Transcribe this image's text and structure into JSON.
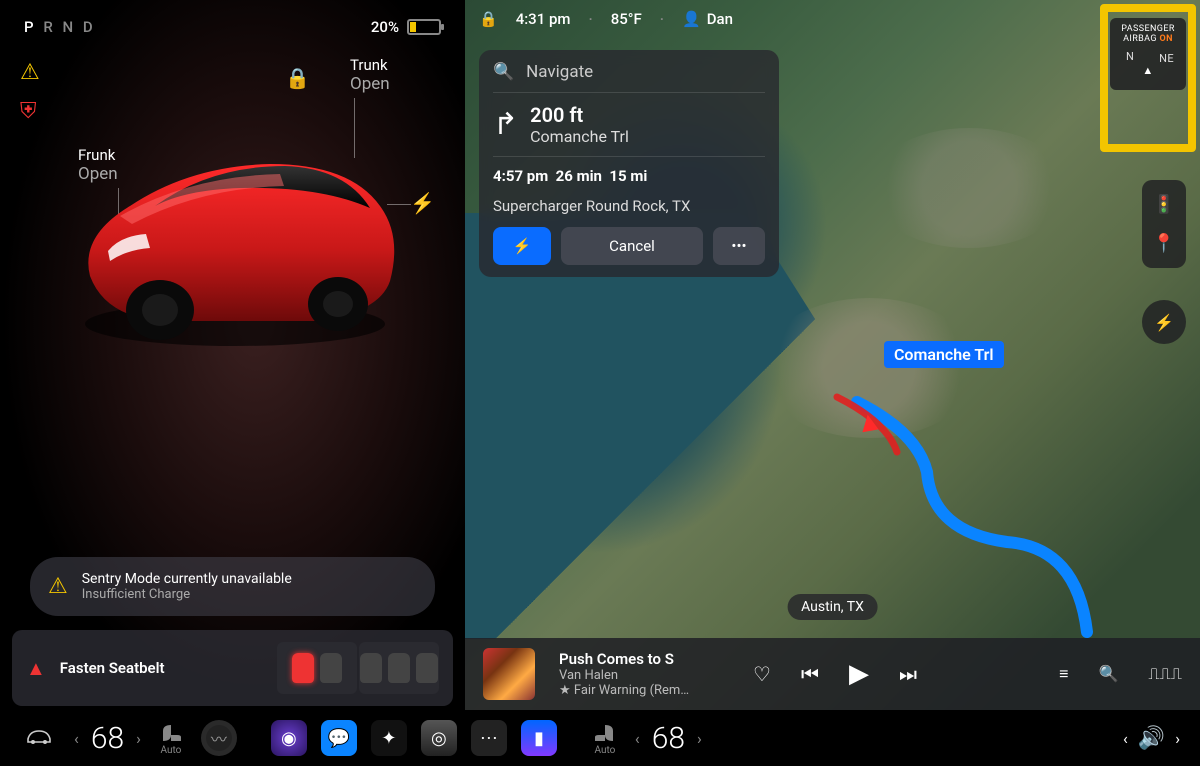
{
  "left": {
    "gears": [
      "P",
      "R",
      "N",
      "D"
    ],
    "active_gear": "P",
    "battery_pct": "20%",
    "trunk_label": "Trunk",
    "trunk_action": "Open",
    "frunk_label": "Frunk",
    "frunk_action": "Open",
    "sentry_title": "Sentry Mode currently unavailable",
    "sentry_sub": "Insufficient Charge",
    "seatbelt_warn": "Fasten Seatbelt"
  },
  "status": {
    "time": "4:31 pm",
    "temp": "85°F",
    "user": "Dan"
  },
  "nav": {
    "search_placeholder": "Navigate",
    "turn_distance": "200 ft",
    "turn_street": "Comanche Trl",
    "eta_time": "4:57 pm",
    "eta_dur": "26 min",
    "eta_dist": "15 mi",
    "destination": "Supercharger Round Rock, TX",
    "cancel": "Cancel",
    "map_road_label": "Comanche Trl",
    "map_city": "Austin, TX"
  },
  "airbag": {
    "line1": "PASSENGER",
    "line2": "AIRBAG",
    "status": "ON",
    "compass_n": "N",
    "compass_ne": "NE"
  },
  "media": {
    "track": "Push Comes to S",
    "artist": "Van Halen",
    "album_line": "Fair Warning (Rem…"
  },
  "dock": {
    "left_temp": "68",
    "right_temp": "68",
    "seat_mode": "Auto"
  },
  "colors": {
    "accent_blue": "#0a6cff",
    "warn_amber": "#f3c500",
    "warn_red": "#e33",
    "highlight": "#f3c500"
  }
}
